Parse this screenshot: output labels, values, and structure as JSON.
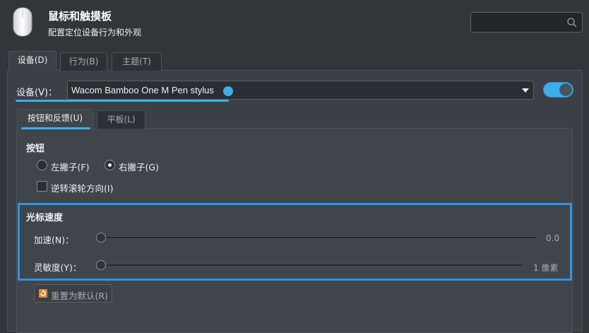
{
  "header": {
    "title": "鼠标和触摸板",
    "subtitle": "配置定位设备行为和外观",
    "search": {
      "placeholder": "",
      "icon": "search-icon"
    },
    "app_icon": "mouse-icon"
  },
  "tabs": [
    {
      "label": "设备(D)",
      "active": true
    },
    {
      "label": "行为(B)",
      "active": false
    },
    {
      "label": "主题(T)",
      "active": false
    }
  ],
  "device": {
    "label": "设备(V)：",
    "selected": "Wacom Bamboo One M Pen stylus",
    "enabled": true
  },
  "subtabs": [
    {
      "label": "按钮和反馈(U)",
      "active": true
    },
    {
      "label": "平板(L)",
      "active": false
    }
  ],
  "buttons_section": {
    "heading": "按钮",
    "left_handed_label": "左撇子(F)",
    "right_handed_label": "右撇子(G)",
    "selected": "right",
    "reverse_scroll_label": "逆转滚轮方向(I)",
    "reverse_scroll_checked": false
  },
  "pointer_speed": {
    "heading": "光标速度",
    "acceleration": {
      "label": "加速(N)：",
      "value_text": "0.0",
      "level": 0
    },
    "sensitivity": {
      "label": "灵敏度(Y)：",
      "value_text": "1 像素",
      "level": 0
    }
  },
  "reset_button": {
    "label": "重置为默认(R)",
    "icon": "reset-icon"
  },
  "colors": {
    "accent": "#3daee9",
    "background": "#31363b",
    "highlight_border": "#2e95e8"
  }
}
